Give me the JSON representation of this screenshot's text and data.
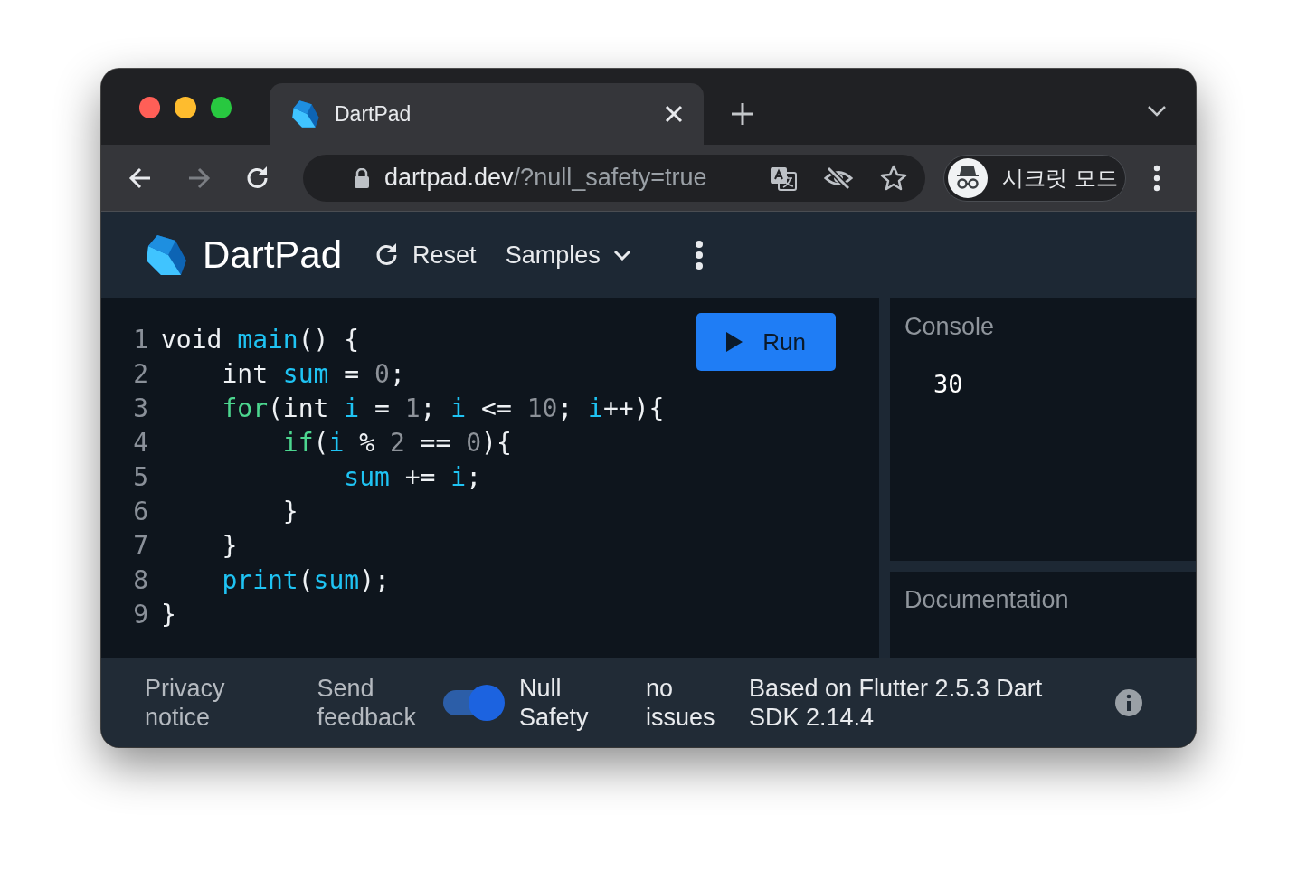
{
  "browser": {
    "tab": {
      "title": "DartPad",
      "selected": true
    },
    "nav": [
      {
        "kind": "back",
        "disabled": false
      },
      {
        "kind": "forward",
        "disabled": true
      },
      {
        "kind": "reload",
        "disabled": false
      }
    ],
    "url": {
      "host": "dartpad.dev",
      "path": "/?null_safety=true"
    },
    "profile": {
      "label": "시크릿 모드"
    }
  },
  "app": {
    "title": "DartPad",
    "toolbar": [
      {
        "kind": "reset",
        "label": "Reset"
      },
      {
        "kind": "samples",
        "label": "Samples"
      }
    ],
    "editor": {
      "run_label": "Run",
      "lines": [
        {
          "number": "1",
          "tokens": [
            {
              "kind": "plain",
              "text": "void "
            },
            {
              "kind": "ident",
              "text": "main"
            },
            {
              "kind": "plain",
              "text": "() {"
            }
          ]
        },
        {
          "number": "2",
          "tokens": [
            {
              "kind": "plain",
              "text": "    int "
            },
            {
              "kind": "ident",
              "text": "sum"
            },
            {
              "kind": "plain",
              "text": " = "
            },
            {
              "kind": "number",
              "text": "0"
            },
            {
              "kind": "plain",
              "text": ";"
            }
          ]
        },
        {
          "number": "3",
          "tokens": [
            {
              "kind": "keyword",
              "text": "    for"
            },
            {
              "kind": "plain",
              "text": "(int "
            },
            {
              "kind": "ident",
              "text": "i"
            },
            {
              "kind": "plain",
              "text": " = "
            },
            {
              "kind": "number",
              "text": "1"
            },
            {
              "kind": "plain",
              "text": "; "
            },
            {
              "kind": "ident",
              "text": "i"
            },
            {
              "kind": "plain",
              "text": " <= "
            },
            {
              "kind": "number",
              "text": "10"
            },
            {
              "kind": "plain",
              "text": "; "
            },
            {
              "kind": "ident",
              "text": "i"
            },
            {
              "kind": "plain",
              "text": "++){"
            }
          ]
        },
        {
          "number": "4",
          "tokens": [
            {
              "kind": "keyword",
              "text": "        if"
            },
            {
              "kind": "plain",
              "text": "("
            },
            {
              "kind": "ident",
              "text": "i"
            },
            {
              "kind": "plain",
              "text": " % "
            },
            {
              "kind": "number",
              "text": "2"
            },
            {
              "kind": "plain",
              "text": " == "
            },
            {
              "kind": "number",
              "text": "0"
            },
            {
              "kind": "plain",
              "text": "){"
            }
          ]
        },
        {
          "number": "5",
          "tokens": [
            {
              "kind": "ident",
              "text": "            sum"
            },
            {
              "kind": "plain",
              "text": " += "
            },
            {
              "kind": "ident",
              "text": "i"
            },
            {
              "kind": "plain",
              "text": ";"
            }
          ]
        },
        {
          "number": "6",
          "tokens": [
            {
              "kind": "plain",
              "text": "        }"
            }
          ]
        },
        {
          "number": "7",
          "tokens": [
            {
              "kind": "plain",
              "text": "    }"
            }
          ]
        },
        {
          "number": "8",
          "tokens": [
            {
              "kind": "ident",
              "text": "    print"
            },
            {
              "kind": "plain",
              "text": "("
            },
            {
              "kind": "ident",
              "text": "sum"
            },
            {
              "kind": "plain",
              "text": ");"
            }
          ]
        },
        {
          "number": "9",
          "tokens": [
            {
              "kind": "plain",
              "text": "}"
            }
          ]
        }
      ]
    },
    "console": {
      "title": "Console",
      "output": "30"
    },
    "documentation": {
      "title": "Documentation"
    },
    "footer": {
      "links": [
        "Privacy notice",
        "Send feedback"
      ],
      "null_safety": {
        "label": "Null Safety",
        "on": true
      },
      "issues": "no issues",
      "version": "Based on Flutter 2.5.3 Dart SDK 2.14.4"
    }
  }
}
